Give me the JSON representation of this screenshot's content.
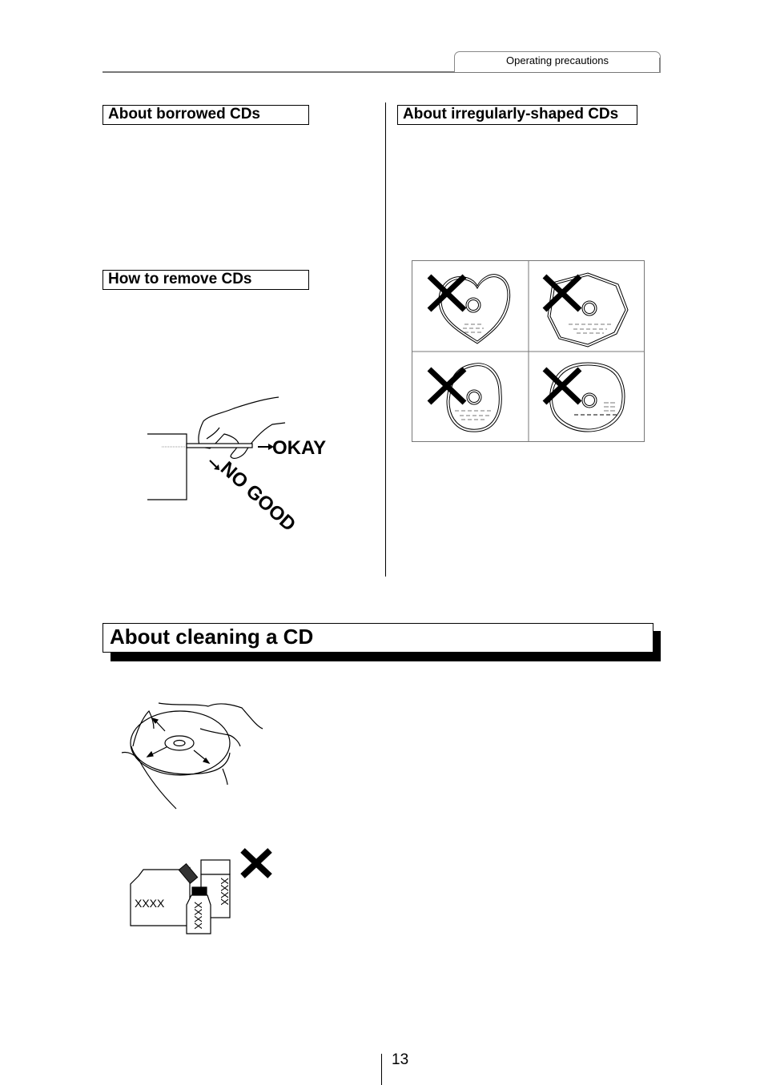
{
  "header": {
    "section_tab": "Operating precautions"
  },
  "left_column": {
    "borrowed_heading": "About borrowed CDs",
    "remove_heading": "How to remove CDs",
    "remove_illustration": {
      "label_okay": "OKAY",
      "label_no_good": "NO GOOD",
      "icon": "hand-removing-disc"
    }
  },
  "right_column": {
    "irregular_heading": "About irregularly-shaped CDs",
    "shape_grid": [
      {
        "shape": "heart",
        "status": "not-allowed"
      },
      {
        "shape": "octagon",
        "status": "not-allowed"
      },
      {
        "shape": "oval",
        "status": "not-allowed"
      },
      {
        "shape": "irregular-round",
        "status": "not-allowed"
      }
    ]
  },
  "cleaning": {
    "heading": "About cleaning a CD",
    "wipe_illustration": "hand-wiping-disc-outward",
    "solvent_illustration": {
      "container_label": "XXXX",
      "bottle_label_1": "XXXX",
      "bottle_label_2": "XXXX",
      "status": "not-allowed"
    }
  },
  "footer": {
    "page_number": "13"
  }
}
